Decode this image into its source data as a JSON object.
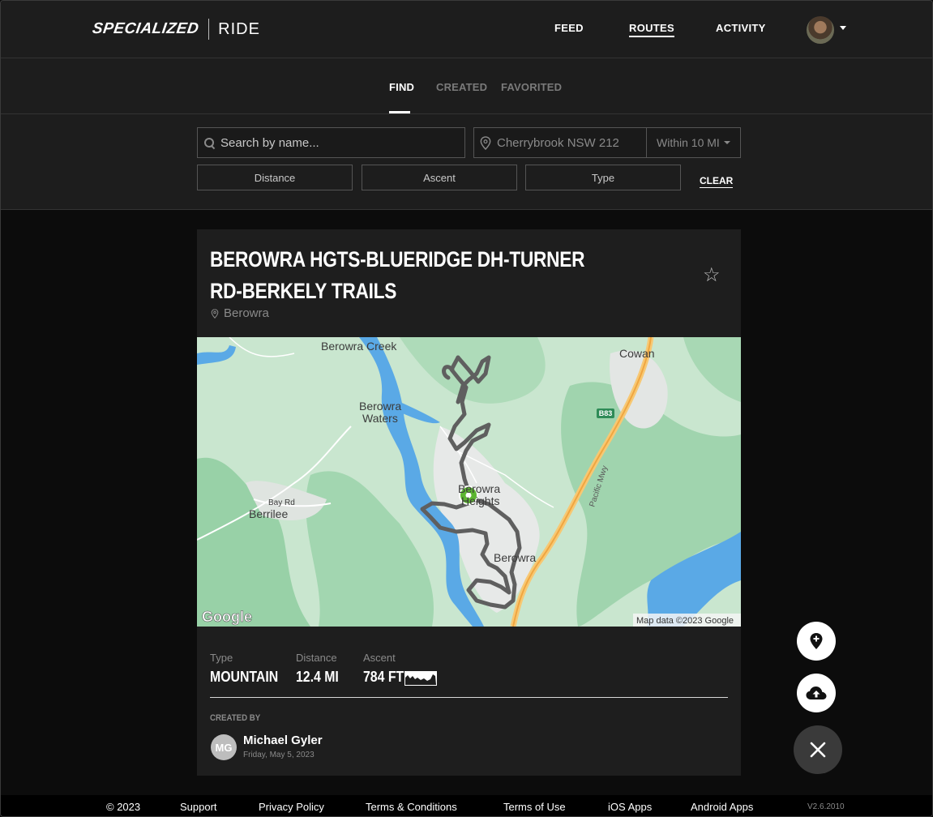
{
  "header": {
    "brand": "SPECIALIZED",
    "app_name": "RIDE",
    "nav": {
      "feed": "FEED",
      "routes": "ROUTES",
      "activity": "ACTIVITY"
    }
  },
  "tabs": {
    "find": "FIND",
    "created": "CREATED",
    "favorited": "FAVORITED"
  },
  "filters": {
    "search_placeholder": "Search by name...",
    "location_value": "Cherrybrook NSW 212",
    "within": "Within 10 MI",
    "distance": "Distance",
    "ascent": "Ascent",
    "type": "Type",
    "clear": "CLEAR"
  },
  "route": {
    "title": "BEROWRA HGTS-BLUERIDGE DH-TURNER RD-BERKELY TRAILS",
    "location": "Berowra",
    "stats": {
      "type_label": "Type",
      "type_value": "MOUNTAIN",
      "distance_label": "Distance",
      "distance_value": "12.4 MI",
      "ascent_label": "Ascent",
      "ascent_value": "784 FT"
    },
    "created_by_label": "CREATED BY",
    "author_initials": "MG",
    "author_name": "Michael Gyler",
    "created_date": "Friday, May 5, 2023"
  },
  "map": {
    "labels": {
      "berowra_creek": "Berowra Creek",
      "cowan": "Cowan",
      "berowra_waters_1": "Berowra",
      "berowra_waters_2": "Waters",
      "bay_rd": "Bay Rd",
      "berrilee": "Berrilee",
      "berowra_heights_1": "Berowra",
      "berowra_heights_2": "Heights",
      "berowra": "Berowra",
      "pacific_mwy": "Pacific Mwy",
      "b83": "B83",
      "google": "Google",
      "attribution": "Map data ©2023 Google"
    }
  },
  "footer": {
    "copyright": "© 2023",
    "support": "Support",
    "privacy": "Privacy Policy",
    "terms_conditions": "Terms & Conditions",
    "terms_use": "Terms of Use",
    "ios": "iOS Apps",
    "android": "Android Apps",
    "version": "V2.6.2010"
  },
  "colors": {
    "accent_start_marker": "#5cb531",
    "route_line": "#5f5f5f"
  }
}
